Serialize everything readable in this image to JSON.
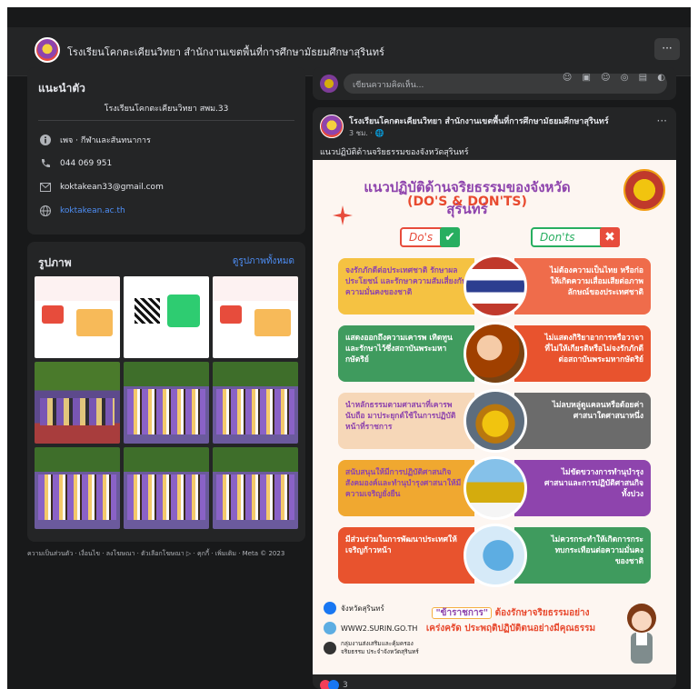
{
  "header": {
    "page_name": "โรงเรียนโคกตะเคียนวิทยา สำนักงานเขตพื้นที่การศึกษามัธยมศึกษาสุรินทร์",
    "more_label": "···"
  },
  "intro": {
    "title": "แนะนำตัว",
    "bio": "โรงเรียนโคกตะเคียนวิทยา สพม.33",
    "category": "เพจ · กีฬาและสันทนาการ",
    "phone": "044 069 951",
    "email": "koktakean33@gmail.com",
    "website": "koktakean.ac.th"
  },
  "photos": {
    "title": "รูปภาพ",
    "see_all": "ดูรูปภาพทั้งหมด"
  },
  "footer_text": "ความเป็นส่วนตัว · เงื่อนไข · ลงโฆษณา · ตัวเลือกโฆษณา ▷ · คุกกี้ · เพิ่มเติม · Meta © 2023",
  "composer": {
    "placeholder": "เขียนความคิดเห็น..."
  },
  "post": {
    "author": "โรงเรียนโคกตะเคียนวิทยา สำนักงานเขตพื้นที่การศึกษามัธยมศึกษาสุรินทร์",
    "time": "3 ชม. · 🌐",
    "text": "แนวปฏิบัติด้านจริยธรรมของจังหวัดสุรินทร์",
    "more_label": "···",
    "reaction_count": "3"
  },
  "poster": {
    "title": "แนวปฏิบัติด้านจริยธรรมของจังหวัดสุรินทร์",
    "subtitle": "(DO'S & DON'TS)",
    "dos_label": "Do's",
    "donts_label": "Don'ts",
    "rows": [
      {
        "do": "จงรักภักดีต่อประเทศชาติ รักษาผลประโยชน์ และรักษาความสัมเสี่ยงกับความมั่นคงของชาติ",
        "dont": "ไม่ต้องความเป็นไทย หรือก่อให้เกิดความเสื่อมเสียต่อภาพลักษณ์ของประเทศชาติ"
      },
      {
        "do": "แสดงออกถึงความเคารพ เทิดทูน และรักษาไว้ซึ่งสถาบันพระมหากษัตริย์",
        "dont": "ไม่แสดงกิริยาอาการหรือวาจาที่ไม่ให้เกียรติหรือไม่จงรักภักดีต่อสถาบันพระมหากษัตริย์"
      },
      {
        "do": "นำหลักธรรมตามศาสนาที่เคารพนับถือ มาประยุกต์ใช้ในการปฏิบัติหน้าที่ราชการ",
        "dont": "ไม่ลบหลู่ดูแคลนหรือด้อยค่าศาสนาใดศาสนาหนึ่ง"
      },
      {
        "do": "สนับสนุนให้มีการปฏิบัติศาสนกิจ สังคมองค์และทำนุบำรุงศาสนาให้มีความเจริญยั่งยืน",
        "dont": "ไม่ขัดขวางการทำนุบำรุงศาสนาและการปฏิบัติศาสนกิจทั้งปวง"
      },
      {
        "do": "มีส่วนร่วมในการพัฒนาประเทศให้เจริญก้าวหน้า",
        "dont": "ไม่ควรกระทำให้เกิดการกระทบกระเทือนต่อความมั่นคงของชาติ"
      }
    ],
    "brand_fb": "จังหวัดสุรินทร์",
    "brand_web": "WWW2.SURIN.GO.TH",
    "brand_org": "กลุ่มงานส่งเสริมและคุ้มครองจริยธรรม ประจำจังหวัดสุรินทร์",
    "slogan_highlight": "\"ข้าราชการ\"",
    "slogan_rest": "ต้องรักษาจริยธรรมอย่างเคร่งครัด ประพฤติปฏิบัติตนอย่างมีคุณธรรม"
  },
  "colors": {
    "bg": "#18191a",
    "card": "#242526",
    "link": "#4e8ff7",
    "purple": "#8e44ad",
    "orange": "#e84a2f",
    "green": "#27ae60"
  }
}
